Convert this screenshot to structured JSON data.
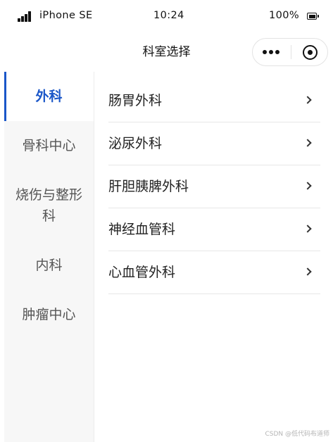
{
  "status_bar": {
    "carrier": "iPhone SE",
    "time": "10:24",
    "battery": "100%"
  },
  "nav": {
    "title": "科室选择"
  },
  "sidebar": {
    "items": [
      {
        "label": "外科"
      },
      {
        "label": "骨科中心"
      },
      {
        "label": "烧伤与整形科"
      },
      {
        "label": "内科"
      },
      {
        "label": "肿瘤中心"
      }
    ]
  },
  "list": {
    "items": [
      {
        "label": "肠胃外科"
      },
      {
        "label": "泌尿外科"
      },
      {
        "label": "肝胆胰脾外科"
      },
      {
        "label": "神经血管科"
      },
      {
        "label": "心血管外科"
      }
    ]
  },
  "watermark": "CSDN @低代码布道师",
  "colors": {
    "accent": "#1a56c8",
    "sidebar_bg": "#f7f7f7"
  },
  "icons": {
    "signal": "signal-bars-icon",
    "battery": "battery-icon",
    "more": "more-dots-icon",
    "close": "target-close-icon",
    "chevron": "chevron-right-icon"
  }
}
